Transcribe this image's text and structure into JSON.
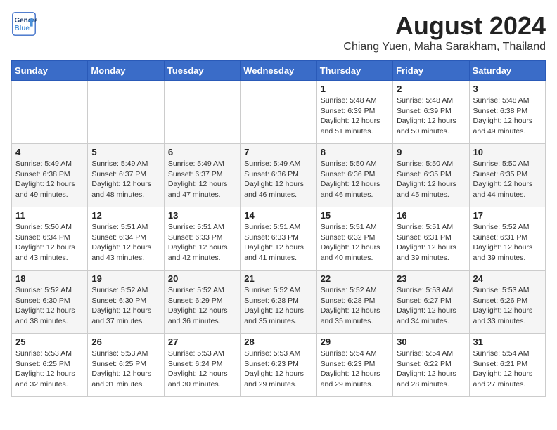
{
  "header": {
    "logo_line1": "General",
    "logo_line2": "Blue",
    "month_year": "August 2024",
    "location": "Chiang Yuen, Maha Sarakham, Thailand"
  },
  "days_of_week": [
    "Sunday",
    "Monday",
    "Tuesday",
    "Wednesday",
    "Thursday",
    "Friday",
    "Saturday"
  ],
  "weeks": [
    [
      {
        "day": "",
        "info": ""
      },
      {
        "day": "",
        "info": ""
      },
      {
        "day": "",
        "info": ""
      },
      {
        "day": "",
        "info": ""
      },
      {
        "day": "1",
        "info": "Sunrise: 5:48 AM\nSunset: 6:39 PM\nDaylight: 12 hours\nand 51 minutes."
      },
      {
        "day": "2",
        "info": "Sunrise: 5:48 AM\nSunset: 6:39 PM\nDaylight: 12 hours\nand 50 minutes."
      },
      {
        "day": "3",
        "info": "Sunrise: 5:48 AM\nSunset: 6:38 PM\nDaylight: 12 hours\nand 49 minutes."
      }
    ],
    [
      {
        "day": "4",
        "info": "Sunrise: 5:49 AM\nSunset: 6:38 PM\nDaylight: 12 hours\nand 49 minutes."
      },
      {
        "day": "5",
        "info": "Sunrise: 5:49 AM\nSunset: 6:37 PM\nDaylight: 12 hours\nand 48 minutes."
      },
      {
        "day": "6",
        "info": "Sunrise: 5:49 AM\nSunset: 6:37 PM\nDaylight: 12 hours\nand 47 minutes."
      },
      {
        "day": "7",
        "info": "Sunrise: 5:49 AM\nSunset: 6:36 PM\nDaylight: 12 hours\nand 46 minutes."
      },
      {
        "day": "8",
        "info": "Sunrise: 5:50 AM\nSunset: 6:36 PM\nDaylight: 12 hours\nand 46 minutes."
      },
      {
        "day": "9",
        "info": "Sunrise: 5:50 AM\nSunset: 6:35 PM\nDaylight: 12 hours\nand 45 minutes."
      },
      {
        "day": "10",
        "info": "Sunrise: 5:50 AM\nSunset: 6:35 PM\nDaylight: 12 hours\nand 44 minutes."
      }
    ],
    [
      {
        "day": "11",
        "info": "Sunrise: 5:50 AM\nSunset: 6:34 PM\nDaylight: 12 hours\nand 43 minutes."
      },
      {
        "day": "12",
        "info": "Sunrise: 5:51 AM\nSunset: 6:34 PM\nDaylight: 12 hours\nand 43 minutes."
      },
      {
        "day": "13",
        "info": "Sunrise: 5:51 AM\nSunset: 6:33 PM\nDaylight: 12 hours\nand 42 minutes."
      },
      {
        "day": "14",
        "info": "Sunrise: 5:51 AM\nSunset: 6:33 PM\nDaylight: 12 hours\nand 41 minutes."
      },
      {
        "day": "15",
        "info": "Sunrise: 5:51 AM\nSunset: 6:32 PM\nDaylight: 12 hours\nand 40 minutes."
      },
      {
        "day": "16",
        "info": "Sunrise: 5:51 AM\nSunset: 6:31 PM\nDaylight: 12 hours\nand 39 minutes."
      },
      {
        "day": "17",
        "info": "Sunrise: 5:52 AM\nSunset: 6:31 PM\nDaylight: 12 hours\nand 39 minutes."
      }
    ],
    [
      {
        "day": "18",
        "info": "Sunrise: 5:52 AM\nSunset: 6:30 PM\nDaylight: 12 hours\nand 38 minutes."
      },
      {
        "day": "19",
        "info": "Sunrise: 5:52 AM\nSunset: 6:30 PM\nDaylight: 12 hours\nand 37 minutes."
      },
      {
        "day": "20",
        "info": "Sunrise: 5:52 AM\nSunset: 6:29 PM\nDaylight: 12 hours\nand 36 minutes."
      },
      {
        "day": "21",
        "info": "Sunrise: 5:52 AM\nSunset: 6:28 PM\nDaylight: 12 hours\nand 35 minutes."
      },
      {
        "day": "22",
        "info": "Sunrise: 5:52 AM\nSunset: 6:28 PM\nDaylight: 12 hours\nand 35 minutes."
      },
      {
        "day": "23",
        "info": "Sunrise: 5:53 AM\nSunset: 6:27 PM\nDaylight: 12 hours\nand 34 minutes."
      },
      {
        "day": "24",
        "info": "Sunrise: 5:53 AM\nSunset: 6:26 PM\nDaylight: 12 hours\nand 33 minutes."
      }
    ],
    [
      {
        "day": "25",
        "info": "Sunrise: 5:53 AM\nSunset: 6:25 PM\nDaylight: 12 hours\nand 32 minutes."
      },
      {
        "day": "26",
        "info": "Sunrise: 5:53 AM\nSunset: 6:25 PM\nDaylight: 12 hours\nand 31 minutes."
      },
      {
        "day": "27",
        "info": "Sunrise: 5:53 AM\nSunset: 6:24 PM\nDaylight: 12 hours\nand 30 minutes."
      },
      {
        "day": "28",
        "info": "Sunrise: 5:53 AM\nSunset: 6:23 PM\nDaylight: 12 hours\nand 29 minutes."
      },
      {
        "day": "29",
        "info": "Sunrise: 5:54 AM\nSunset: 6:23 PM\nDaylight: 12 hours\nand 29 minutes."
      },
      {
        "day": "30",
        "info": "Sunrise: 5:54 AM\nSunset: 6:22 PM\nDaylight: 12 hours\nand 28 minutes."
      },
      {
        "day": "31",
        "info": "Sunrise: 5:54 AM\nSunset: 6:21 PM\nDaylight: 12 hours\nand 27 minutes."
      }
    ]
  ]
}
